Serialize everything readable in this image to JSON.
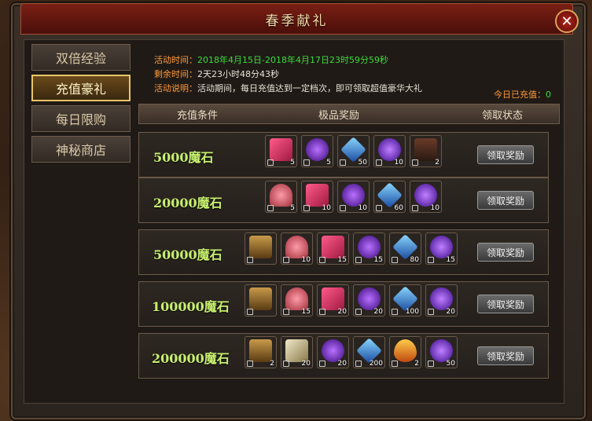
{
  "window": {
    "title": "春季献礼",
    "close_label": "✕"
  },
  "tabs": [
    {
      "label": "双倍经验",
      "active": false
    },
    {
      "label": "充值豪礼",
      "active": true
    },
    {
      "label": "每日限购",
      "active": false
    },
    {
      "label": "神秘商店",
      "active": false
    }
  ],
  "info": {
    "time_label": "活动时间：",
    "time_value": "2018年4月15日-2018年4月17日23时59分59秒",
    "remain_label": "剩余时间：",
    "remain_value": "2天23小时48分43秒",
    "desc_label": "活动说明：",
    "desc_value": "活动期间，每日充值达到一定档次，即可领取超值豪华大礼",
    "today_label": "今日已充值：",
    "today_value": "0"
  },
  "table": {
    "headers": [
      "充值条件",
      "极品奖励",
      "领取状态"
    ],
    "claim_label": "领取奖励",
    "rows": [
      {
        "requirement": "5000魔石",
        "items": [
          {
            "icon": "gift-icon",
            "count": "5"
          },
          {
            "icon": "soul-20-icon",
            "count": "5"
          },
          {
            "icon": "blue-gem-icon",
            "count": "50"
          },
          {
            "icon": "exp-orb-icon",
            "count": "10"
          },
          {
            "icon": "potion-icon",
            "count": "2"
          }
        ]
      },
      {
        "requirement": "20000魔石",
        "items": [
          {
            "icon": "lotus-icon",
            "count": "5"
          },
          {
            "icon": "gift-icon",
            "count": "10"
          },
          {
            "icon": "soul-20-icon",
            "count": "10"
          },
          {
            "icon": "blue-gem-icon",
            "count": "60"
          },
          {
            "icon": "exp-orb-icon",
            "count": "10"
          }
        ]
      },
      {
        "requirement": "50000魔石",
        "items": [
          {
            "icon": "chest-icon",
            "count": ""
          },
          {
            "icon": "lotus-icon",
            "count": "10"
          },
          {
            "icon": "gift-icon",
            "count": "15"
          },
          {
            "icon": "soul-20-icon",
            "count": "15"
          },
          {
            "icon": "blue-gem-icon",
            "count": "80"
          },
          {
            "icon": "exp-orb-icon",
            "count": "15"
          }
        ]
      },
      {
        "requirement": "100000魔石",
        "items": [
          {
            "icon": "chest-icon",
            "count": ""
          },
          {
            "icon": "lotus-icon",
            "count": "15"
          },
          {
            "icon": "gift-icon",
            "count": "20"
          },
          {
            "icon": "soul-20-icon",
            "count": "20"
          },
          {
            "icon": "blue-gem-icon",
            "count": "100"
          },
          {
            "icon": "exp-orb-icon",
            "count": "20"
          }
        ]
      },
      {
        "requirement": "200000魔石",
        "items": [
          {
            "icon": "chest-icon",
            "count": "2"
          },
          {
            "icon": "white-gift-icon",
            "count": "20"
          },
          {
            "icon": "soul-30-icon",
            "count": "20"
          },
          {
            "icon": "blue-gem-icon",
            "count": "200"
          },
          {
            "icon": "flame-gem-icon",
            "count": "2"
          },
          {
            "icon": "exp-orb-icon",
            "count": "50"
          }
        ]
      }
    ]
  }
}
